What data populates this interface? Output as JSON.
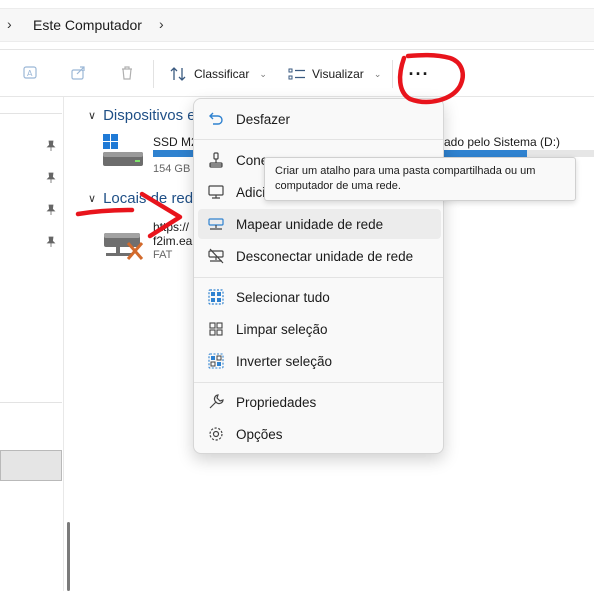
{
  "address": {
    "crumb": "Este Computador"
  },
  "toolbar": {
    "sort_label": "Classificar",
    "view_label": "Visualizar",
    "more_label": "···"
  },
  "content": {
    "groups": [
      {
        "label": "Dispositivos e"
      },
      {
        "label": "Locais de rede"
      }
    ],
    "drive": {
      "name": "SSD M2",
      "size": "154 GB",
      "name_right": "ado pelo Sistema (D:)",
      "usage": 0.55
    },
    "network": {
      "name": "https://",
      "sub_name": "f2im.ea",
      "fs": "FAT"
    }
  },
  "menu": {
    "items": [
      {
        "label": "Desfazer",
        "icon": "undo-icon"
      },
      {
        "label": "Conec",
        "icon": "map-drive-icon"
      },
      {
        "label": "Adicio",
        "icon": "add-network-icon"
      },
      {
        "label": "Mapear unidade de rede",
        "icon": "network-drive-icon"
      },
      {
        "label": "Desconectar unidade de rede",
        "icon": "disconnect-drive-icon"
      },
      {
        "label": "Selecionar tudo",
        "icon": "select-all-icon"
      },
      {
        "label": "Limpar seleção",
        "icon": "clear-selection-icon"
      },
      {
        "label": "Inverter seleção",
        "icon": "invert-selection-icon"
      },
      {
        "label": "Propriedades",
        "icon": "wrench-icon"
      },
      {
        "label": "Opções",
        "icon": "gear-icon"
      }
    ],
    "tooltip": "Criar um atalho para uma pasta compartilhada ou um computador de uma rede."
  },
  "colors": {
    "accent": "#2f82d0",
    "annotation": "#e8141c",
    "group_text": "#1f4f86"
  }
}
